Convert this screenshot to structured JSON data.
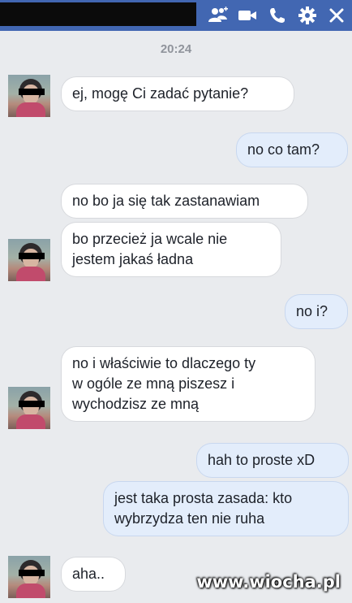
{
  "header": {
    "icons": [
      "add-person-icon",
      "video-camera-icon",
      "phone-icon",
      "gear-icon",
      "close-icon"
    ],
    "brand_color": "#4267b2"
  },
  "chat": {
    "timestamp": "20:24",
    "messages": [
      {
        "side": "in",
        "text": "ej, mogę Ci zadać pytanie?"
      },
      {
        "side": "out",
        "text": "no co tam?"
      },
      {
        "side": "in",
        "text": "no bo ja się tak zastanawiam"
      },
      {
        "side": "in",
        "text": "bo przecież ja wcale nie\njestem jakaś ładna"
      },
      {
        "side": "out",
        "text": "no i?"
      },
      {
        "side": "in",
        "text": "no i właściwie to dlaczego ty\nw ogóle ze mną piszesz i\nwychodzisz ze mną"
      },
      {
        "side": "out",
        "text": "hah to proste xD"
      },
      {
        "side": "out",
        "text": "jest taka prosta zasada: kto\nwybrzydza ten nie ruha"
      },
      {
        "side": "in",
        "text": "aha.."
      }
    ]
  },
  "watermark": "www.wiocha.pl"
}
